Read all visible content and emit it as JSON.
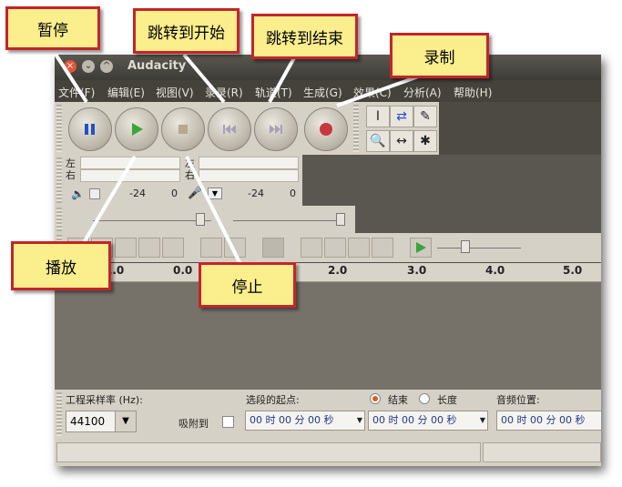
{
  "window": {
    "title": "Audacity",
    "controls": [
      "×",
      "⌄",
      "^"
    ]
  },
  "menu": [
    "文件(F)",
    "编辑(E)",
    "视图(V)",
    "录录(R)",
    "轨道(T)",
    "生成(G)",
    "效果(C)",
    "分析(A)",
    "帮助(H)"
  ],
  "transport": {
    "icons": [
      "pause-icon",
      "play-icon",
      "stop-icon",
      "skip-to-start-icon",
      "skip-to-end-icon",
      "record-icon"
    ]
  },
  "tools": [
    "I",
    "⇄",
    "✎",
    "🔍",
    "↔",
    "✱"
  ],
  "meters": {
    "left": "左",
    "right": "右",
    "neg24a": "-24",
    "zeroA": "0",
    "neg24b": "-24",
    "zeroB": "0"
  },
  "ruler": {
    "ticks": [
      "1.0",
      "0.0",
      "2.0",
      "3.0",
      "4.0",
      "5.0"
    ]
  },
  "selection": {
    "rate_label": "工程采样率 (Hz):",
    "rate_value": "44100",
    "snap_label": "吸附到",
    "start_label": "选段的起点:",
    "end_label": "结束",
    "length_label": "长度",
    "audio_pos_label": "音频位置:",
    "time1": "00 时 00 分 00 秒",
    "time2": "00 时 00 分 00 秒",
    "time3": "00 时 00 分 00 秒"
  },
  "callouts": {
    "pause": "暂停",
    "skip_start": "跳转到开始",
    "skip_end": "跳转到结束",
    "record": "录制",
    "play": "播放",
    "stop": "停止"
  },
  "colors": {
    "callout_bg": "#fbee8c",
    "callout_border": "#c5242a",
    "pause": "#2450c8",
    "play": "#3aa63a",
    "record": "#c8373c"
  }
}
